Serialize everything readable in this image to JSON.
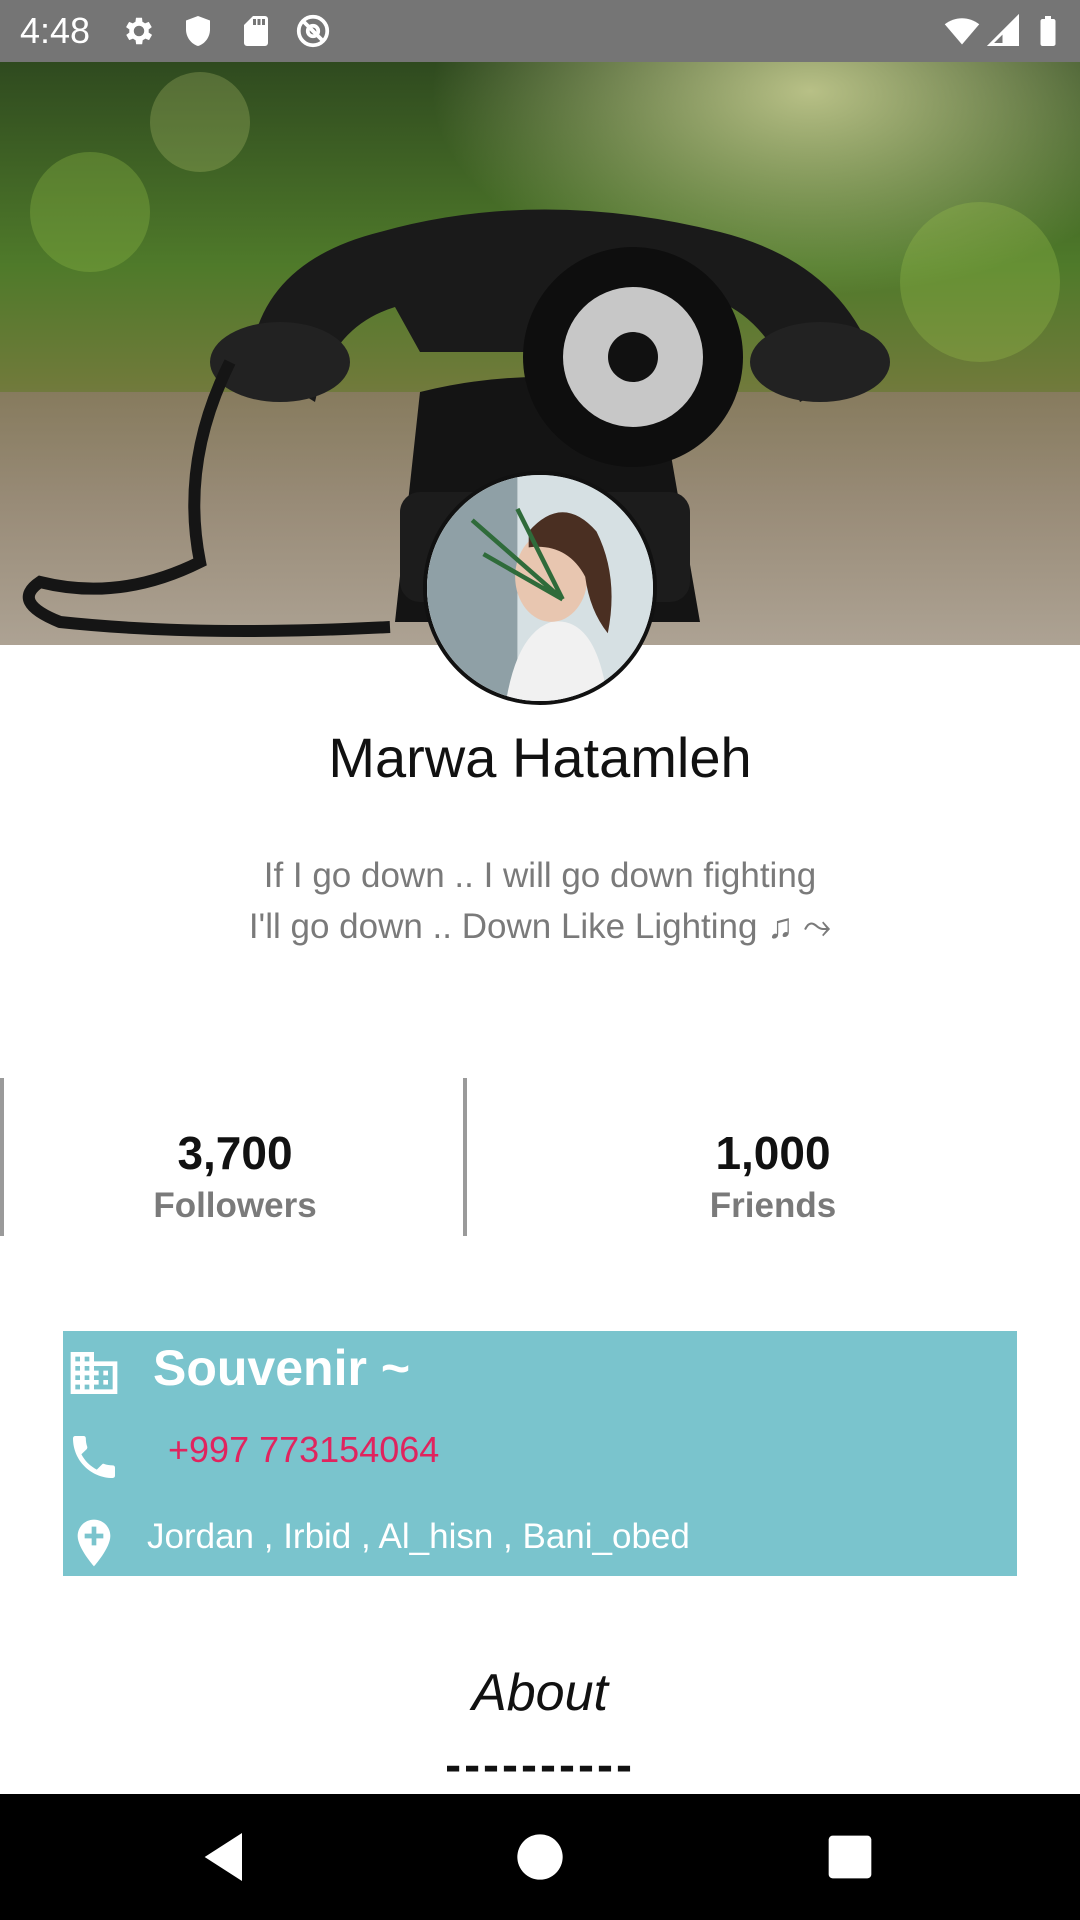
{
  "status_bar": {
    "time": "4:48",
    "icons": [
      "gear-icon",
      "shield-icon",
      "sd-card-icon",
      "at-sign-icon",
      "wifi-icon",
      "cell-signal-icon",
      "battery-icon"
    ]
  },
  "profile": {
    "name": "Marwa Hatamleh",
    "bio_line1": "If I go down .. I will go down fighting",
    "bio_line2": "I'll go down .. Down Like Lighting ♫ ⤳"
  },
  "stats": {
    "followers_value": "3,700",
    "followers_label": "Followers",
    "friends_value": "1,000",
    "friends_label": "Friends"
  },
  "info": {
    "company": "Souvenir ~",
    "phone": "+997 773154064",
    "location": "Jordan , Irbid , Al_hisn , Bani_obed",
    "card_color": "#7ac4cd",
    "phone_color": "#e0245e"
  },
  "about": {
    "title": "About",
    "divider": "----------"
  },
  "nav": {
    "icons": [
      "back-icon",
      "home-icon",
      "recents-icon"
    ]
  }
}
